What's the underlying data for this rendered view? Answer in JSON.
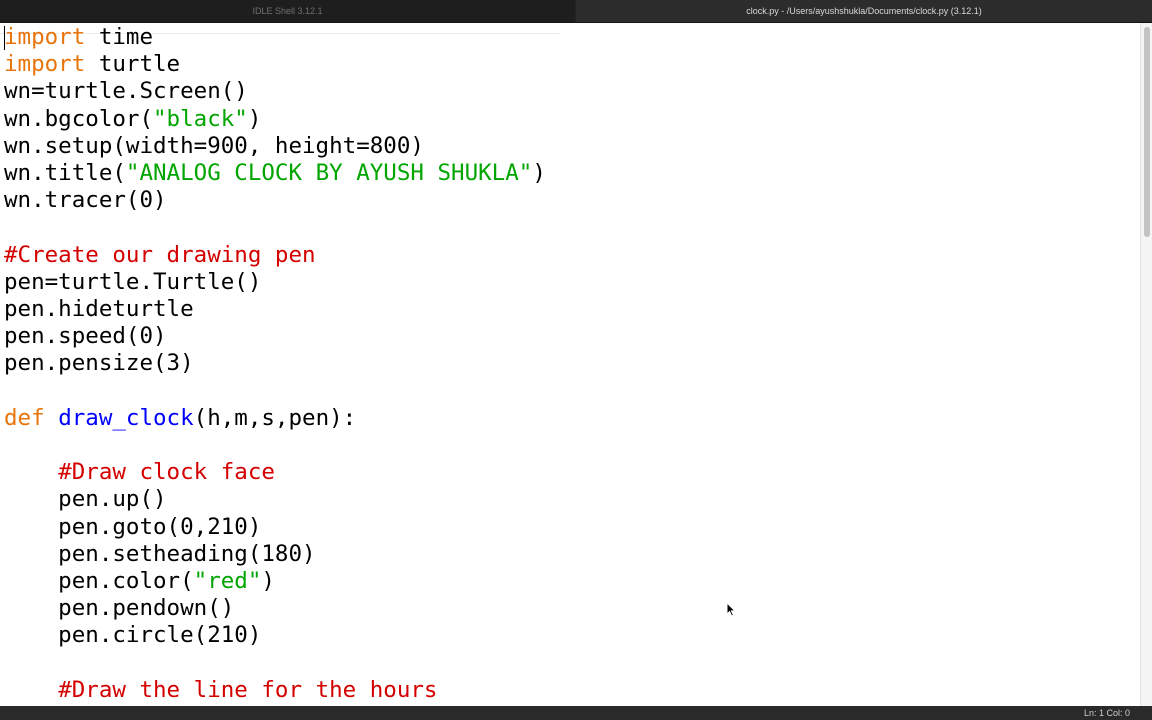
{
  "titlebar": {
    "shell_tab": "IDLE Shell 3.12.1",
    "editor_tab": "clock.py - /Users/ayushshukla/Documents/clock.py (3.12.1)"
  },
  "colors": {
    "keyword": "#e8740c",
    "string": "#00a500",
    "comment": "#d40000",
    "definition": "#0000ff",
    "default": "#000000"
  },
  "code_lines": [
    [
      {
        "t": "import",
        "c": "keyword"
      },
      {
        "t": " time",
        "c": "default"
      }
    ],
    [
      {
        "t": "import",
        "c": "keyword"
      },
      {
        "t": " turtle",
        "c": "default"
      }
    ],
    [
      {
        "t": "wn=turtle.Screen()",
        "c": "default"
      }
    ],
    [
      {
        "t": "wn.bgcolor(",
        "c": "default"
      },
      {
        "t": "\"black\"",
        "c": "string"
      },
      {
        "t": ")",
        "c": "default"
      }
    ],
    [
      {
        "t": "wn.setup(width=900, height=800)",
        "c": "default"
      }
    ],
    [
      {
        "t": "wn.title(",
        "c": "default"
      },
      {
        "t": "\"ANALOG CLOCK BY AYUSH SHUKLA\"",
        "c": "string"
      },
      {
        "t": ")",
        "c": "default"
      }
    ],
    [
      {
        "t": "wn.tracer(0)",
        "c": "default"
      }
    ],
    [],
    [
      {
        "t": "#Create our drawing pen",
        "c": "comment"
      }
    ],
    [
      {
        "t": "pen=turtle.Turtle()",
        "c": "default"
      }
    ],
    [
      {
        "t": "pen.hideturtle",
        "c": "default"
      }
    ],
    [
      {
        "t": "pen.speed(0)",
        "c": "default"
      }
    ],
    [
      {
        "t": "pen.pensize(3)",
        "c": "default"
      }
    ],
    [],
    [
      {
        "t": "def",
        "c": "keyword"
      },
      {
        "t": " ",
        "c": "default"
      },
      {
        "t": "draw_clock",
        "c": "definition"
      },
      {
        "t": "(h,m,s,pen):",
        "c": "default"
      }
    ],
    [],
    [
      {
        "t": "    ",
        "c": "default"
      },
      {
        "t": "#Draw clock face",
        "c": "comment"
      }
    ],
    [
      {
        "t": "    pen.up()",
        "c": "default"
      }
    ],
    [
      {
        "t": "    pen.goto(0,210)",
        "c": "default"
      }
    ],
    [
      {
        "t": "    pen.setheading(180)",
        "c": "default"
      }
    ],
    [
      {
        "t": "    pen.color(",
        "c": "default"
      },
      {
        "t": "\"red\"",
        "c": "string"
      },
      {
        "t": ")",
        "c": "default"
      }
    ],
    [
      {
        "t": "    pen.pendown()",
        "c": "default"
      }
    ],
    [
      {
        "t": "    pen.circle(210)",
        "c": "default"
      }
    ],
    [],
    [
      {
        "t": "    ",
        "c": "default"
      },
      {
        "t": "#Draw the line for the hours",
        "c": "comment"
      }
    ]
  ],
  "status": {
    "position": "Ln: 1  Col: 0"
  }
}
